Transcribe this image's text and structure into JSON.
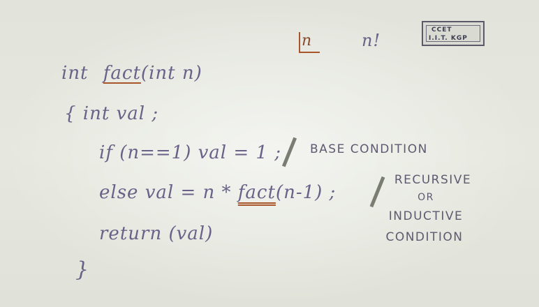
{
  "corner": {
    "box_n": "n",
    "factorial": "n!"
  },
  "logo": {
    "line1": "CCET",
    "line2": "I.I.T. KGP"
  },
  "code": {
    "line1_type": "int",
    "line1_name": "fact",
    "line1_params": "(int n)",
    "line2": "{ int val ;",
    "line3": "if (n==1)  val = 1 ;",
    "line4_pre": "else   val =  n *",
    "line4_call": "fact",
    "line4_post": "(n-1) ;",
    "line5": "return (val)",
    "line6": "}"
  },
  "comments": {
    "base": "BASE CONDITION",
    "recursive_1": "RECURSIVE",
    "recursive_2": "OR",
    "recursive_3": "INDUCTIVE",
    "recursive_4": "CONDITION"
  }
}
